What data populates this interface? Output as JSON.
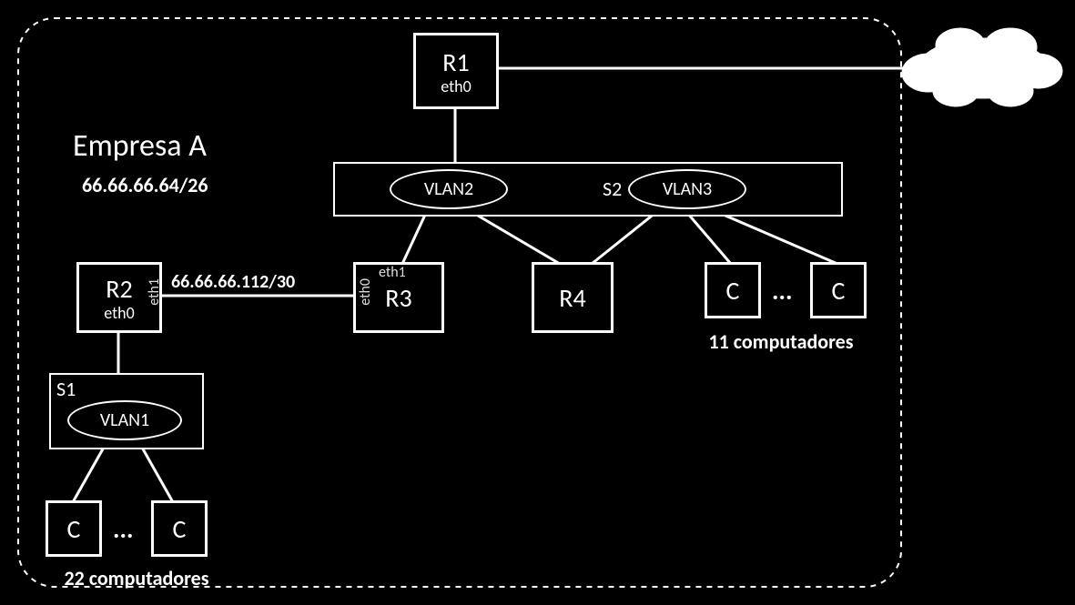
{
  "company": {
    "title": "Empresa A",
    "subnet": "66.66.66.64/26"
  },
  "link_r2_r3": "66.66.66.112/30",
  "routers": {
    "r1": {
      "name": "R1",
      "iface_below": "eth0"
    },
    "r2": {
      "name": "R2",
      "iface_below": "eth0",
      "iface_right": "eth1"
    },
    "r3": {
      "name": "R3",
      "iface_left": "eth0",
      "iface_top": "eth1"
    },
    "r4": {
      "name": "R4"
    }
  },
  "switches": {
    "s1": {
      "label": "S1",
      "vlan": "VLAN1"
    },
    "s2": {
      "label": "S2",
      "vlan_left": "VLAN2",
      "vlan_right": "VLAN3"
    }
  },
  "hosts": {
    "c_label": "C",
    "dots": "...",
    "group_bottom_count": "22 computadores",
    "group_right_count": "11 computadores"
  },
  "cloud_label": ""
}
